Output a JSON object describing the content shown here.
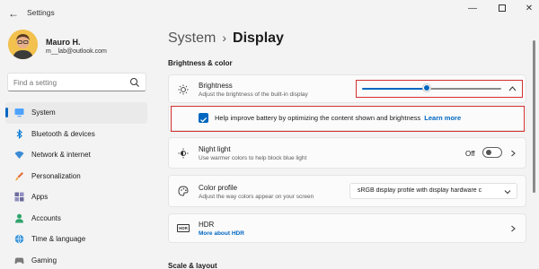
{
  "window": {
    "title": "Settings",
    "back_glyph": "←",
    "min_glyph": "—",
    "close_glyph": "✕"
  },
  "user": {
    "name": "Mauro H.",
    "email": "m__lab@outlook.com"
  },
  "search": {
    "placeholder": "Find a setting",
    "icon": "search-icon"
  },
  "sidebar": {
    "items": [
      {
        "label": "System",
        "icon": "monitor-icon",
        "active": true
      },
      {
        "label": "Bluetooth & devices",
        "icon": "bluetooth-icon"
      },
      {
        "label": "Network & internet",
        "icon": "wifi-icon"
      },
      {
        "label": "Personalization",
        "icon": "brush-icon"
      },
      {
        "label": "Apps",
        "icon": "apps-icon"
      },
      {
        "label": "Accounts",
        "icon": "person-icon"
      },
      {
        "label": "Time & language",
        "icon": "globe-icon"
      },
      {
        "label": "Gaming",
        "icon": "controller-icon"
      }
    ]
  },
  "breadcrumb": {
    "parent": "System",
    "separator": "›",
    "current": "Display"
  },
  "sections": {
    "brightness_color": "Brightness & color",
    "scale_layout": "Scale & layout"
  },
  "brightness": {
    "title": "Brightness",
    "subtitle": "Adjust the brightness of the built-in display",
    "value_fraction": 0.47
  },
  "battery_option": {
    "label": "Help improve battery by optimizing the content shown and brightness",
    "link": "Learn more",
    "checked": true
  },
  "night_light": {
    "title": "Night light",
    "subtitle": "Use warmer colors to help block blue light",
    "state_label": "Off"
  },
  "color_profile": {
    "title": "Color profile",
    "subtitle": "Adjust the way colors appear on your screen",
    "selected": "sRGB display profile with display hardware c"
  },
  "hdr": {
    "title": "HDR",
    "link": "More about HDR",
    "badge": "HDR"
  },
  "colors": {
    "accent": "#0067c0",
    "highlight_border": "#d32f2f"
  }
}
